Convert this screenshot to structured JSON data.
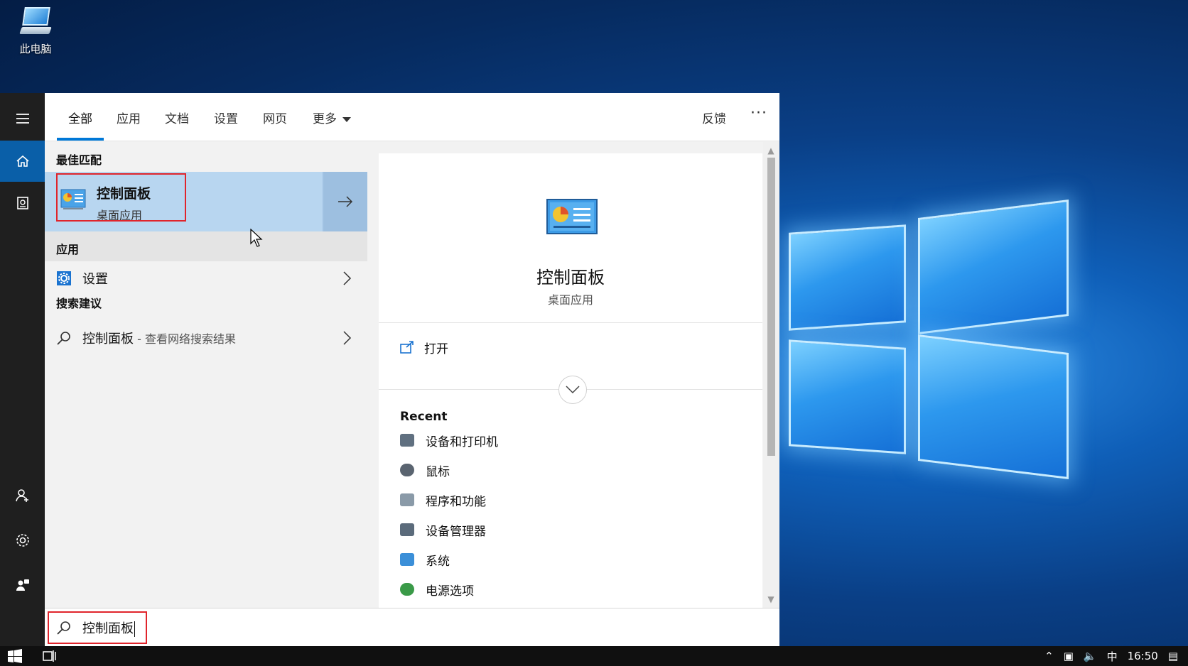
{
  "desktop": {
    "icon_label": "此电脑"
  },
  "tabs": [
    {
      "label": "全部",
      "active": true
    },
    {
      "label": "应用"
    },
    {
      "label": "文档"
    },
    {
      "label": "设置"
    },
    {
      "label": "网页"
    },
    {
      "label": "更多"
    }
  ],
  "feedback_label": "反馈",
  "more_dots": "···",
  "best_match": {
    "heading": "最佳匹配",
    "title": "控制面板",
    "subtitle": "桌面应用"
  },
  "apps": {
    "heading": "应用",
    "items": [
      {
        "label": "设置"
      }
    ]
  },
  "suggestions": {
    "heading": "搜索建议",
    "items": [
      {
        "label": "控制面板",
        "hint": " - 查看网络搜索结果"
      }
    ]
  },
  "preview": {
    "title": "控制面板",
    "subtitle": "桌面应用",
    "open_label": "打开",
    "recent_heading": "Recent",
    "recent_items": [
      {
        "label": "设备和打印机",
        "color": "#607080"
      },
      {
        "label": "鼠标",
        "color": "#5a6470"
      },
      {
        "label": "程序和功能",
        "color": "#8a9aa8"
      },
      {
        "label": "设备管理器",
        "color": "#5b6b7b"
      },
      {
        "label": "系统",
        "color": "#3b8fd8"
      },
      {
        "label": "电源选项",
        "color": "#3a9a48"
      }
    ]
  },
  "search": {
    "value": "控制面板"
  },
  "taskbar": {
    "ime": "中",
    "time": "16:50"
  },
  "colors": {
    "accent": "#0078d7",
    "highlight_box": "#e0242b",
    "selected_row": "#b8d6f0"
  }
}
